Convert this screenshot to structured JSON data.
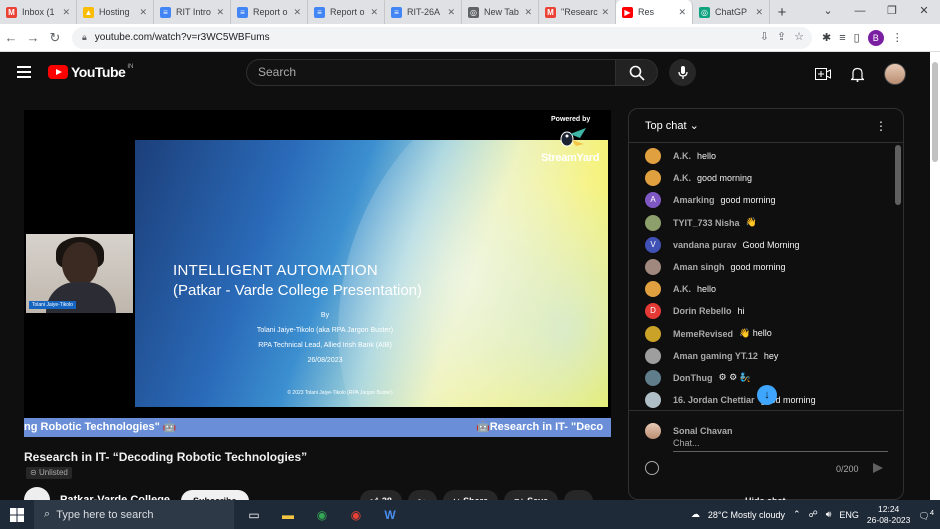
{
  "browser": {
    "tabs": [
      {
        "title": "Inbox (1",
        "favicon_color": "#ea4335",
        "glyph": "M"
      },
      {
        "title": "Hosting",
        "favicon_color": "#fbbc04",
        "glyph": "▲"
      },
      {
        "title": "RIT Intro",
        "favicon_color": "#4285f4",
        "glyph": "≡"
      },
      {
        "title": "Report o",
        "favicon_color": "#4285f4",
        "glyph": "≡"
      },
      {
        "title": "Report o",
        "favicon_color": "#4285f4",
        "glyph": "≡"
      },
      {
        "title": "RIT-26A",
        "favicon_color": "#4285f4",
        "glyph": "≡"
      },
      {
        "title": "New Tab",
        "favicon_color": "#5f6368",
        "glyph": "◎"
      },
      {
        "title": "\"Researc",
        "favicon_color": "#ea4335",
        "glyph": "M"
      },
      {
        "title": "Res",
        "favicon_color": "#ff0000",
        "glyph": "▶",
        "active": true
      },
      {
        "title": "ChatGP",
        "favicon_color": "#10a37f",
        "glyph": "◎"
      }
    ],
    "new_tab_label": "+",
    "url": "youtube.com/watch?v=r3WC5WBFums",
    "profile_initial": "B"
  },
  "youtube": {
    "logo_text": "YouTube",
    "region": "IN",
    "search_placeholder": "Search"
  },
  "video": {
    "powered_by": "Powered by",
    "streamyard": "StreamYard",
    "slide_title": "INTELLIGENT AUTOMATION",
    "slide_subtitle": "(Patkar - Varde College Presentation)",
    "slide_by": "By",
    "slide_author": "Tolani Jaiye-Tikolo (aka RPA Jargon Buster)",
    "slide_role": "RPA Technical Lead, Allied Irish Bank (AIB)",
    "slide_date": "26/08/2023",
    "slide_copyright": "© 2023 Tolani Jaiye-Tikolo (RPA Jargon Buster)",
    "presenter_name": "Tolani Jaiye-Tikolo",
    "ticker_left": "ng Robotic Technologies\" 🤖",
    "ticker_right": "🤖Research in IT- \"Deco"
  },
  "details": {
    "title": "Research in IT- “Decoding Robotic Technologies”",
    "unlisted": "Unlisted",
    "channel": "Patkar-Varde College",
    "subscribe": "Subscribe",
    "likes": "38",
    "share": "Share",
    "save": "Save",
    "more": "···"
  },
  "chat": {
    "header": "Top chat",
    "messages": [
      {
        "author": "A.K.",
        "text": "hello",
        "avatar_color": "#e0a040",
        "initial": ""
      },
      {
        "author": "A.K.",
        "text": "good morning",
        "avatar_color": "#e0a040",
        "initial": ""
      },
      {
        "author": "Amarking",
        "text": "good morning",
        "avatar_color": "#7e57c2",
        "initial": "A"
      },
      {
        "author": "TYIT_733 Nisha",
        "text": "👋",
        "avatar_color": "#8d9f6a",
        "initial": ""
      },
      {
        "author": "vandana purav",
        "text": "Good Morning",
        "avatar_color": "#3f51b5",
        "initial": "V"
      },
      {
        "author": "Aman singh",
        "text": "good morning",
        "avatar_color": "#a1887f",
        "initial": ""
      },
      {
        "author": "A.K.",
        "text": "hello",
        "avatar_color": "#e0a040",
        "initial": ""
      },
      {
        "author": "Dorin Rebello",
        "text": "hi",
        "avatar_color": "#e53935",
        "initial": "D"
      },
      {
        "author": "MemeRevised",
        "text": "👋 hello",
        "avatar_color": "#c9a227",
        "initial": ""
      },
      {
        "author": "Aman gaming YT.12",
        "text": "hey",
        "avatar_color": "#9e9e9e",
        "initial": ""
      },
      {
        "author": "DonThug",
        "text": "⚙ ⚙ 🧞",
        "avatar_color": "#607d8b",
        "initial": ""
      },
      {
        "author": "16. Jordan Chettiar",
        "text": "good morning",
        "avatar_color": "#b0bec5",
        "initial": ""
      }
    ],
    "input_user": "Sonal Chavan",
    "input_placeholder": "Chat...",
    "char_count": "0/200",
    "hide_chat": "Hide chat"
  },
  "taskbar": {
    "search_placeholder": "Type here to search",
    "weather": "28°C  Mostly cloudy",
    "lang": "ENG",
    "time": "12:24",
    "date": "26-08-2023",
    "notif_count": "4"
  }
}
